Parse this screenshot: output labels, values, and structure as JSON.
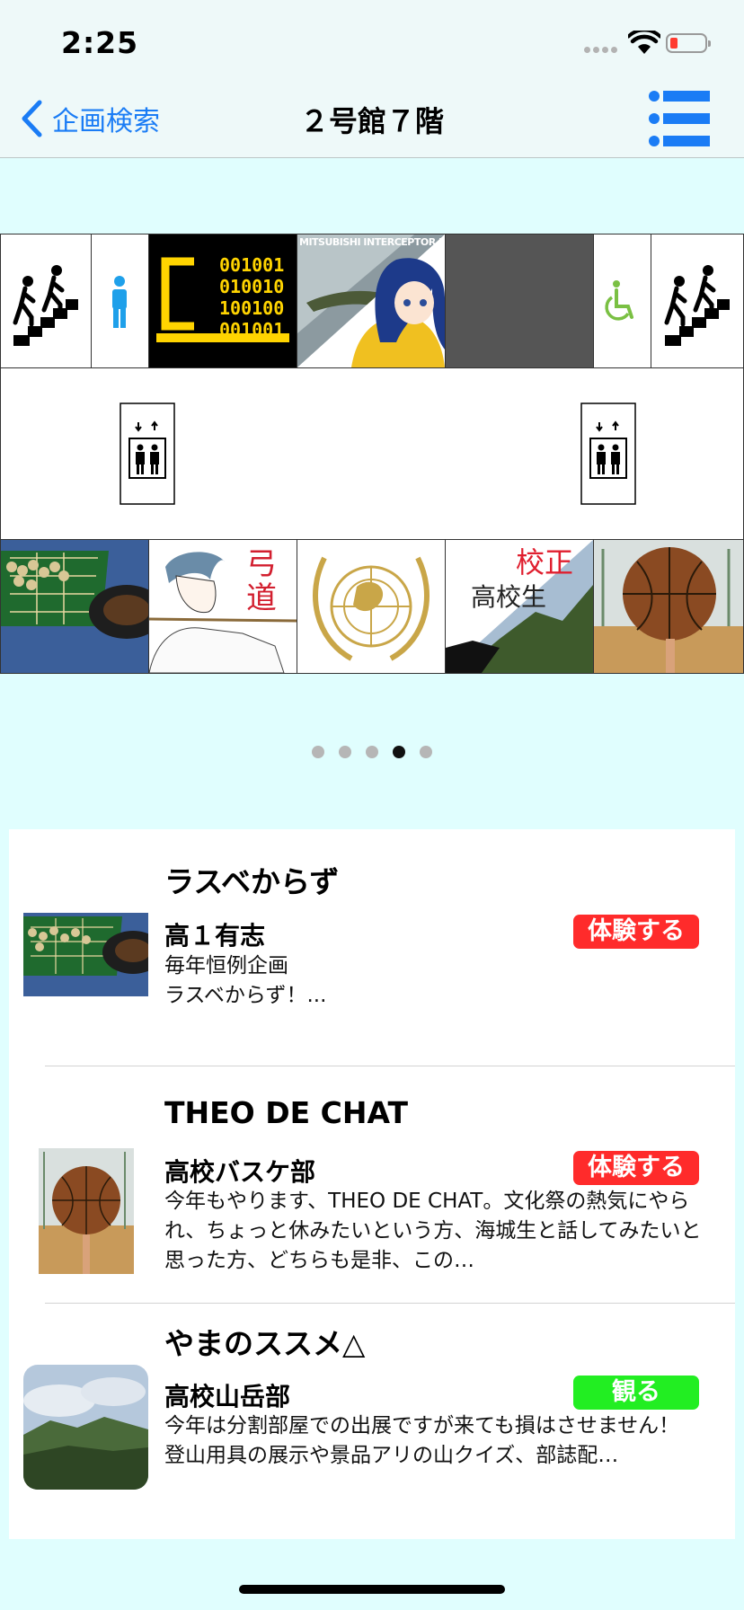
{
  "status_bar": {
    "time": "2:25"
  },
  "nav": {
    "back_label": "企画検索",
    "title": "２号館７階"
  },
  "map": {
    "binary_lines": [
      "001001",
      "010010",
      "100100",
      "001001"
    ],
    "poster_text": "MITSUBISHI INTERCEPTOR RAIDEN",
    "kyudo_text": [
      "弓",
      "道"
    ],
    "kousei_text": "校正",
    "kousei_sub": "高校生"
  },
  "pager": {
    "count": 5,
    "active_index": 3
  },
  "list": {
    "items": [
      {
        "title": "ラスベからず",
        "org": "高１有志",
        "badge": "体験する",
        "badge_color": "#ff2b2b",
        "description": "毎年恒例企画\nラスベからず！..."
      },
      {
        "title": "THEO DE CHAT",
        "org": "高校バスケ部",
        "badge": "体験する",
        "badge_color": "#ff2b2b",
        "description": "今年もやります、THEO DE CHAT。文化祭の熱気にやられ、ちょっと休みたいという方、海城生と話してみたいと思った方、どちらも是非、この…"
      },
      {
        "title": "やまのススメ△",
        "org": "高校山岳部",
        "badge": "観る",
        "badge_color": "#22ee22",
        "description": "今年は分割部屋での出展ですが来ても損はさせません！\n登山用具の展示や景品アリの山クイズ、部誌配…"
      }
    ]
  }
}
